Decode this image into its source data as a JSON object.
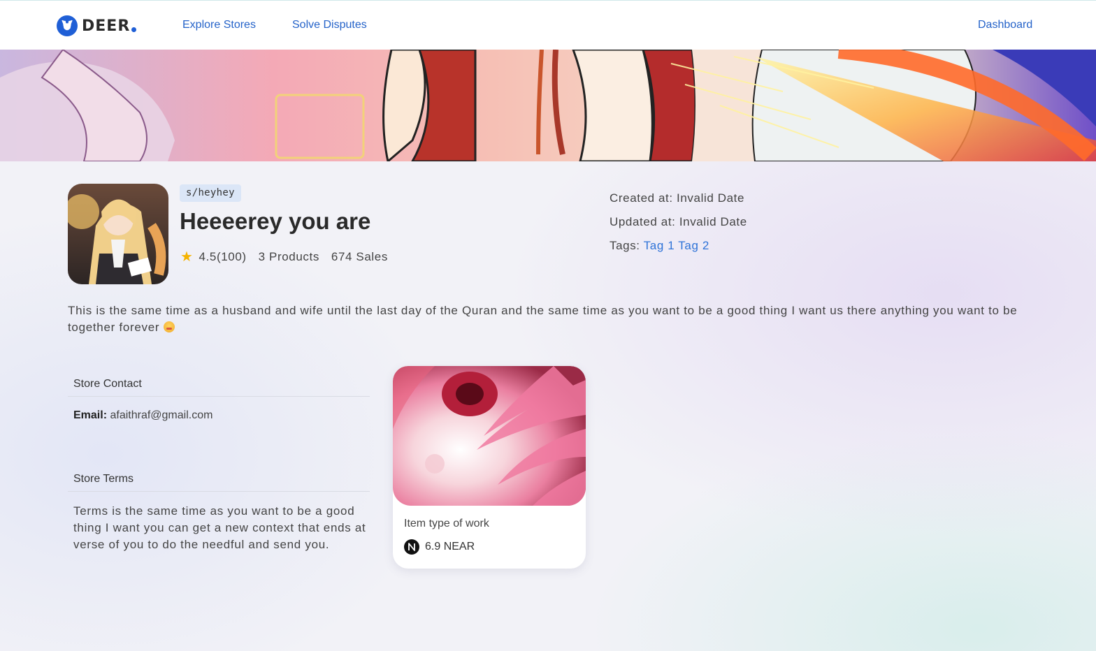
{
  "nav": {
    "logo_text": "DEER",
    "links": [
      "Explore Stores",
      "Solve Disputes"
    ],
    "dashboard": "Dashboard"
  },
  "store": {
    "handle": "s/heyhey",
    "name": "Heeeerey you are",
    "rating": "4.5(100)",
    "products": "3 Products",
    "sales": "674 Sales",
    "created_label": "Created at:",
    "created_value": "Invalid Date",
    "updated_label": "Updated at:",
    "updated_value": "Invalid Date",
    "tags_label": "Tags:",
    "tags": [
      "Tag 1",
      "Tag 2"
    ],
    "description": "This is the same time as a husband and wife until the last day of the Quran and the same time as you want to be a good thing I want us there anything you want to be together forever"
  },
  "contact": {
    "title": "Store Contact",
    "email_label": "Email:",
    "email_value": "afaithraf@gmail.com"
  },
  "terms": {
    "title": "Store Terms",
    "text": "Terms is the same time as you want to be a good thing I want you can get a new context that ends at verse of you to do the needful and send you."
  },
  "product": {
    "title": "Item type of work",
    "price": "6.9 NEAR"
  },
  "colors": {
    "accent": "#2563c9",
    "badge_bg": "#dbe6f7",
    "star": "#f5b301"
  },
  "icons": {
    "logo": "deer-logo-icon",
    "rating": "star-icon",
    "currency": "near-icon"
  }
}
